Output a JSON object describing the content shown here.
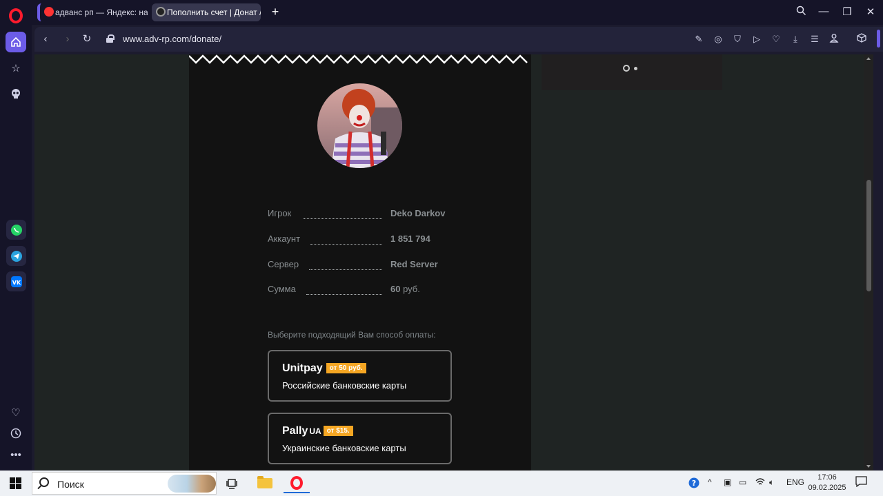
{
  "browser": {
    "tabs": [
      {
        "label": "адванс рп — Яндекс: наш"
      },
      {
        "label": "Пополнить счет | Донат /"
      }
    ],
    "url": "www.adv-rp.com/donate/"
  },
  "player_info": [
    {
      "label": "Игрок",
      "value": "Deko Darkov",
      "unit": ""
    },
    {
      "label": "Аккаунт",
      "value": "1 851 794",
      "unit": ""
    },
    {
      "label": "Сервер",
      "value": "Red Server",
      "unit": ""
    },
    {
      "label": "Сумма",
      "value": "60",
      "unit": " руб."
    }
  ],
  "payment": {
    "prompt": "Выберите подходящий Вам способ оплаты:",
    "methods": [
      {
        "name": "Unitpay",
        "suffix": "",
        "badge": "от 50 руб.",
        "description": "Российские банковские карты"
      },
      {
        "name": "Pally",
        "suffix": "UA",
        "badge": "от $15.",
        "description": "Украинские банковские карты"
      }
    ]
  },
  "taskbar": {
    "search_placeholder": "Поиск",
    "language": "ENG",
    "time": "17:06",
    "date": "09.02.2025"
  },
  "colors": {
    "accent": "#6c5ce7",
    "badge": "#f5a623",
    "panel": "#121212",
    "page_bg": "#1f2423"
  }
}
